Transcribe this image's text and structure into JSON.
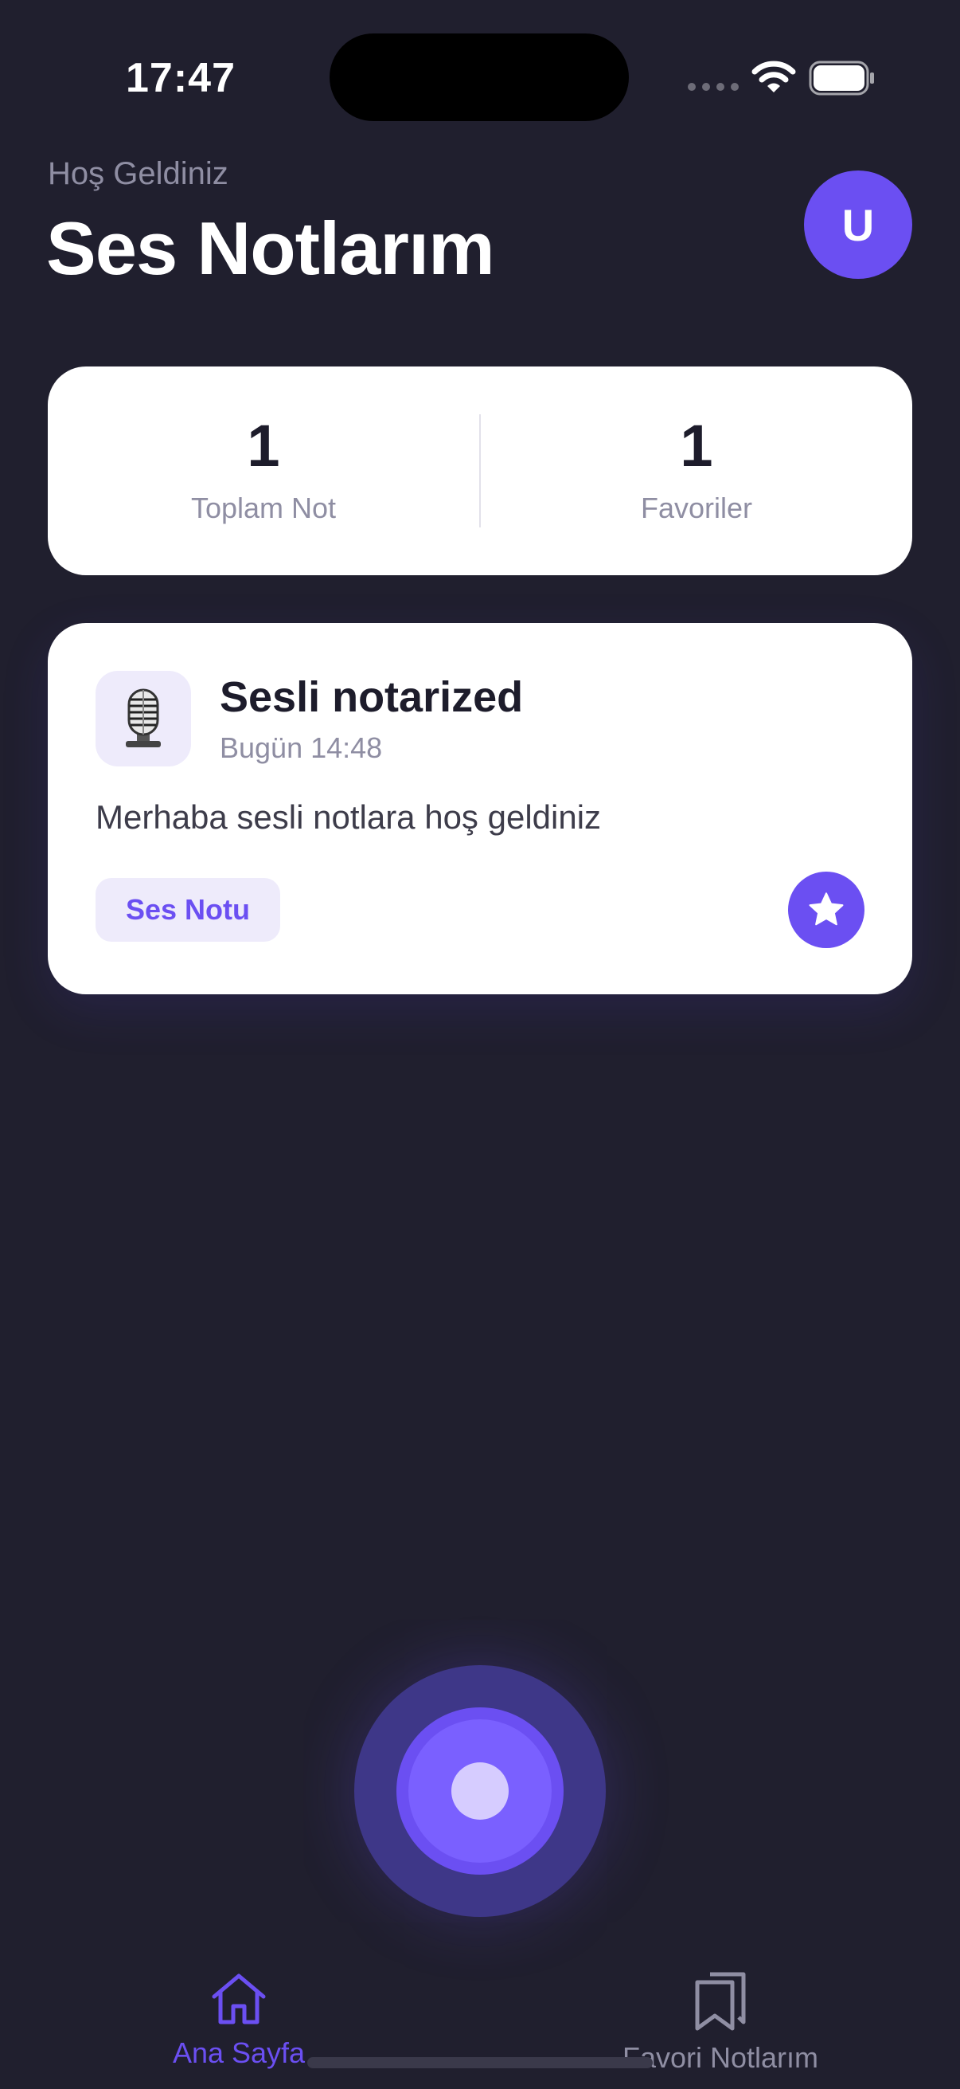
{
  "status_bar": {
    "time": "17:47"
  },
  "header": {
    "greeting": "Hoş Geldiniz",
    "title": "Ses Notlarım",
    "avatar_initial": "U"
  },
  "stats": {
    "total": {
      "value": "1",
      "label": "Toplam Not"
    },
    "favorites": {
      "value": "1",
      "label": "Favoriler"
    }
  },
  "notes": [
    {
      "icon": "microphone-icon",
      "title": "Sesli notarized",
      "date": "Bugün 14:48",
      "body": "Merhaba sesli notlara hoş geldiniz",
      "tag": "Ses Notu",
      "favorite": true
    }
  ],
  "tab_bar": {
    "home_label": "Ana Sayfa",
    "favorites_label": "Favori Notlarım",
    "active": "home"
  },
  "colors": {
    "background": "#201f2e",
    "accent": "#6b4ff2",
    "card": "#ffffff",
    "muted_text": "#8f8ea3"
  }
}
